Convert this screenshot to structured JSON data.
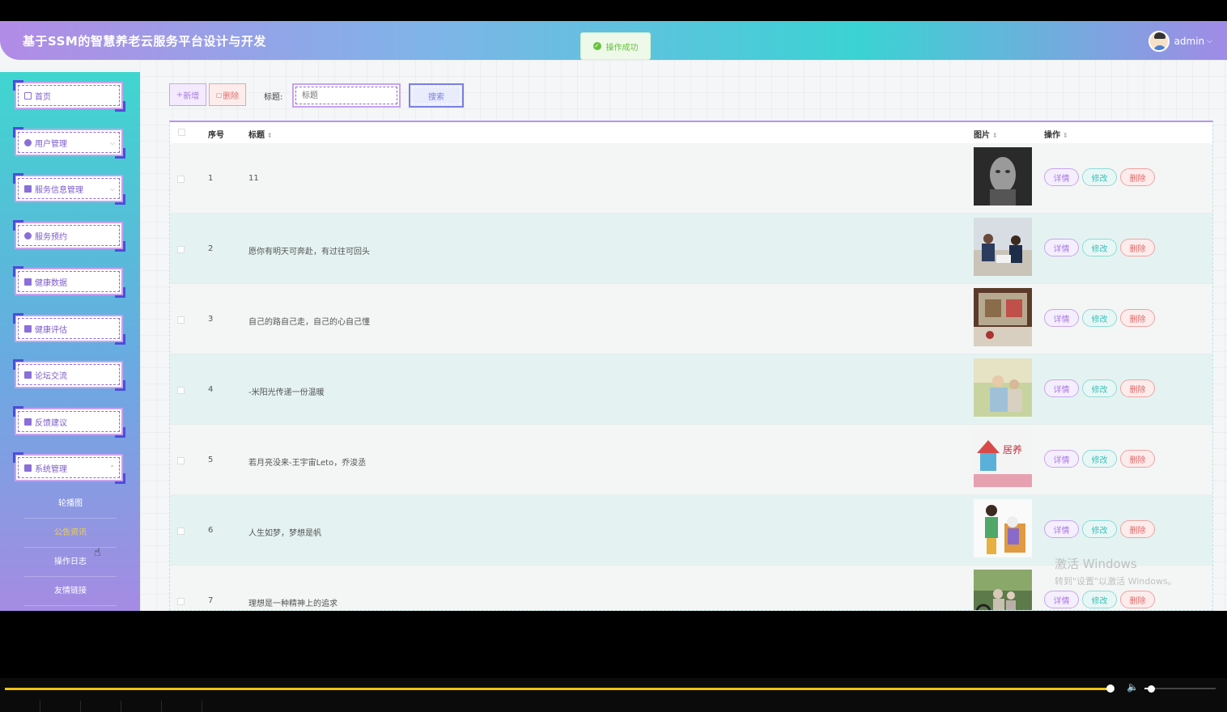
{
  "header": {
    "title": "基于SSM的智慧养老云服务平台设计与开发",
    "user": "admin",
    "user_chevron": "⌵"
  },
  "toast": {
    "text": "操作成功"
  },
  "sidebar": {
    "items": [
      {
        "label": "首页",
        "icon": "home-icon"
      },
      {
        "label": "用户管理",
        "icon": "user-icon",
        "expandable": true
      },
      {
        "label": "服务信息管理",
        "icon": "grid-icon",
        "expandable": true
      },
      {
        "label": "服务预约",
        "icon": "clock-icon"
      },
      {
        "label": "健康数据",
        "icon": "mail-icon"
      },
      {
        "label": "健康评估",
        "icon": "grid-icon"
      },
      {
        "label": "论坛交流",
        "icon": "chat-icon"
      },
      {
        "label": "反馈建议",
        "icon": "chart-icon"
      },
      {
        "label": "系统管理",
        "icon": "grid-icon",
        "expanded": true
      }
    ],
    "subitems": [
      {
        "label": "轮播图",
        "active": false
      },
      {
        "label": "公告资讯",
        "active": true
      },
      {
        "label": "操作日志",
        "active": false
      },
      {
        "label": "友情链接",
        "active": false
      }
    ]
  },
  "toolbar": {
    "add_label": "新增",
    "delete_label": "删除",
    "search_label": "标题:",
    "search_placeholder": "标题",
    "search_button": "搜索"
  },
  "table": {
    "columns": [
      "序号",
      "标题",
      "图片",
      "操作"
    ],
    "rows": [
      {
        "num": "1",
        "title": "11"
      },
      {
        "num": "2",
        "title": "愿你有明天可奔赴，有过往可回头"
      },
      {
        "num": "3",
        "title": "自己的路自己走，自己的心自己懂"
      },
      {
        "num": "4",
        "title": "-米阳光传递一份温暖"
      },
      {
        "num": "5",
        "title": "若月亮没来-王宇宙Leto，乔浚丞"
      },
      {
        "num": "6",
        "title": "人生如梦，梦想是帆"
      },
      {
        "num": "7",
        "title": "理想是一种精神上的追求"
      }
    ],
    "actions": {
      "detail": "详情",
      "edit": "修改",
      "remove": "删除"
    }
  },
  "watermark": {
    "line1": "激活 Windows",
    "line2": "转到\"设置\"以激活 Windows。"
  },
  "player": {
    "progress": 0.9
  }
}
